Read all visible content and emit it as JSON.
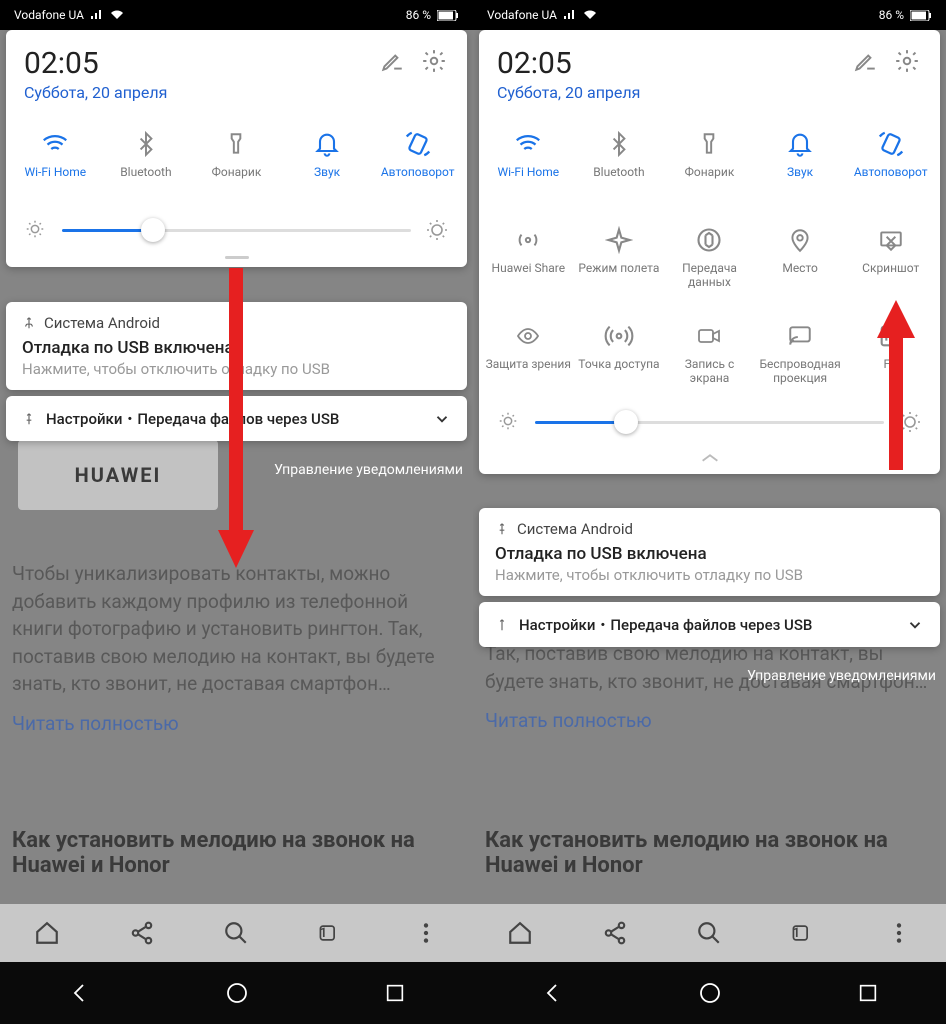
{
  "status": {
    "carrier": "Vodafone UA",
    "battery": "86 %"
  },
  "panel": {
    "time": "02:05",
    "date": "Суббота, 20 апреля"
  },
  "tilesRow1": [
    {
      "label": "Wi-Fi Home",
      "active": true,
      "icon": "wifi"
    },
    {
      "label": "Bluetooth",
      "active": false,
      "icon": "bluetooth"
    },
    {
      "label": "Фонарик",
      "active": false,
      "icon": "flashlight"
    },
    {
      "label": "Звук",
      "active": true,
      "icon": "bell"
    },
    {
      "label": "Автоповорот",
      "active": true,
      "icon": "rotate"
    }
  ],
  "tilesRow2": [
    {
      "label": "Huawei Share",
      "active": false,
      "icon": "share"
    },
    {
      "label": "Режим полета",
      "active": false,
      "icon": "airplane"
    },
    {
      "label": "Передача данных",
      "active": false,
      "icon": "data"
    },
    {
      "label": "Место",
      "active": false,
      "icon": "location"
    },
    {
      "label": "Скриншот",
      "active": false,
      "icon": "screenshot"
    }
  ],
  "tilesRow3": [
    {
      "label": "Защита зрения",
      "active": false,
      "icon": "eye"
    },
    {
      "label": "Точка доступа",
      "active": false,
      "icon": "hotspot"
    },
    {
      "label": "Запись с экрана",
      "active": false,
      "icon": "record"
    },
    {
      "label": "Беспроводная проекция",
      "active": false,
      "icon": "cast"
    },
    {
      "label": "FC",
      "active": false,
      "icon": "nfc"
    }
  ],
  "notif1": {
    "app": "Система Android",
    "title": "Отладка по USB включена",
    "text": "Нажмите, чтобы отключить отладку по USB"
  },
  "notif2": {
    "text": "Настройки・Передача файлов через USB"
  },
  "mgmt": "Управление уведомлениями",
  "bgTextFull": "Чтобы уникализировать контакты, можно добавить каждому профилю из телефонной книги фотографию и установить рингтон. Так, поставив свою мелодию на контакт, вы будете знать, кто звонит, не доставая смартфон…",
  "bgTextPartial": "Так, поставив свою мелодию на контакт, вы будете знать, кто звонит, не доставая смартфон…",
  "bgLink": "Читать полностью",
  "bgHeading": "Как установить мелодию на звонок на Huawei и Honor",
  "huaweiLogo": "HUAWEI",
  "tabCount": "1"
}
